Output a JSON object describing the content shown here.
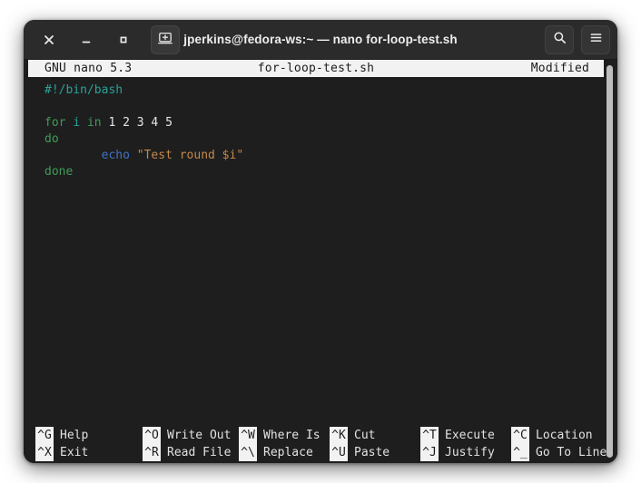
{
  "window": {
    "title": "jperkins@fedora-ws:~ — nano for-loop-test.sh",
    "controls": {
      "close": "×",
      "minimize": "−",
      "maximize": "□",
      "new_terminal": "new-terminal"
    },
    "header_buttons": {
      "search": "search",
      "menu": "menu"
    },
    "colors": {
      "titlebar_bg": "#2b2b2b",
      "terminal_bg": "#1e1e1e",
      "page_bg": "#ffffff"
    }
  },
  "nano": {
    "titlebar": {
      "version": "GNU nano 5.3",
      "filename": "for-loop-test.sh",
      "status": "Modified"
    },
    "lines": [
      [
        {
          "t": "#!/bin/bash",
          "c": "comment"
        }
      ],
      [
        {
          "t": "",
          "c": "plain"
        }
      ],
      [
        {
          "t": "for",
          "c": "keyword"
        },
        {
          "t": " ",
          "c": "plain"
        },
        {
          "t": "i",
          "c": "var"
        },
        {
          "t": " ",
          "c": "plain"
        },
        {
          "t": "in",
          "c": "keyword"
        },
        {
          "t": " ",
          "c": "plain"
        },
        {
          "t": "1 2 3 4 5",
          "c": "num"
        }
      ],
      [
        {
          "t": "do",
          "c": "keyword"
        }
      ],
      [
        {
          "t": "        ",
          "c": "plain"
        },
        {
          "t": "echo",
          "c": "builtin"
        },
        {
          "t": " ",
          "c": "plain"
        },
        {
          "t": "\"Test round $i\"",
          "c": "string"
        }
      ],
      [
        {
          "t": "done",
          "c": "keyword"
        }
      ]
    ],
    "shortcuts_row1": [
      {
        "key": "^G",
        "label": "Help"
      },
      {
        "key": "^O",
        "label": "Write Out"
      },
      {
        "key": "^W",
        "label": "Where Is"
      },
      {
        "key": "^K",
        "label": "Cut"
      },
      {
        "key": "^T",
        "label": "Execute"
      },
      {
        "key": "^C",
        "label": "Location"
      }
    ],
    "shortcuts_row2": [
      {
        "key": "^X",
        "label": "Exit"
      },
      {
        "key": "^R",
        "label": "Read File"
      },
      {
        "key": "^\\",
        "label": "Replace"
      },
      {
        "key": "^U",
        "label": "Paste"
      },
      {
        "key": "^J",
        "label": "Justify"
      },
      {
        "key": "^_",
        "label": "Go To Line"
      }
    ]
  }
}
